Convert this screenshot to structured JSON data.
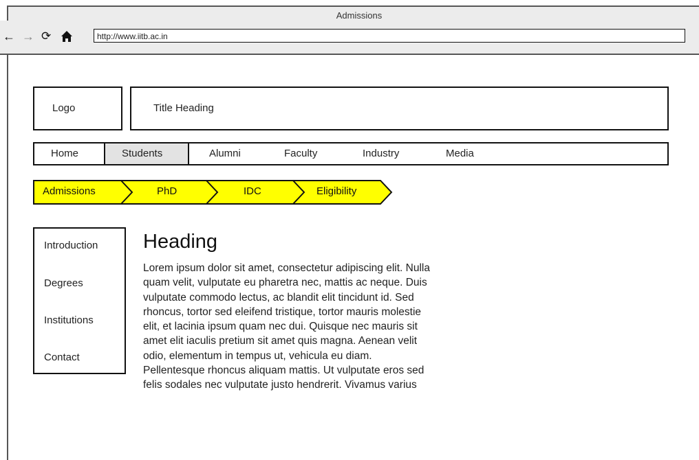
{
  "browser": {
    "window_title": "Admissions",
    "url": "http://www.iitb.ac.in",
    "icons": [
      "back-arrow-icon",
      "forward-arrow-icon",
      "reload-icon",
      "home-icon"
    ]
  },
  "header": {
    "logo": "Logo",
    "title": "Title Heading"
  },
  "menu": {
    "items": [
      "Home",
      "Students",
      "Alumni",
      "Faculty",
      "Industry",
      "Media"
    ],
    "active": "Students"
  },
  "breadcrumb": {
    "items": [
      "Admissions",
      "PhD",
      "IDC",
      "Eligibility"
    ],
    "color": "#ffff00"
  },
  "sidebar": {
    "items": [
      "Introduction",
      "Degrees",
      "Institutions",
      "Contact"
    ]
  },
  "content": {
    "heading": "Heading",
    "lines": [
      "Lorem ipsum dolor sit amet, consectetur adipiscing elit. Nulla",
      "quam velit, vulputate eu pharetra nec, mattis ac neque. Duis",
      "vulputate commodo lectus, ac blandit elit tincidunt id. Sed",
      "rhoncus, tortor sed eleifend tristique, tortor mauris molestie",
      "elit, et lacinia ipsum quam nec dui. Quisque nec mauris sit",
      "amet elit iaculis pretium sit amet quis magna. Aenean velit",
      "odio, elementum in tempus ut, vehicula eu diam.",
      "Pellentesque rhoncus aliquam mattis. Ut vulputate eros sed",
      "felis sodales nec vulputate justo hendrerit. Vivamus varius"
    ]
  }
}
